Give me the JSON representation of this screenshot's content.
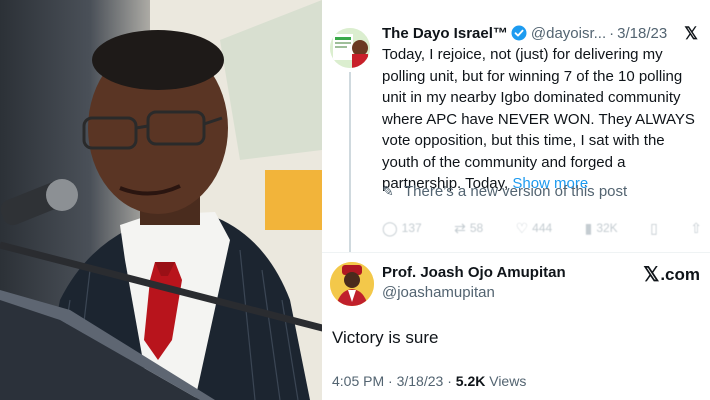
{
  "tweet1": {
    "author_name": "The Dayo Israel™",
    "handle": "@dayoisr...",
    "separator": "·",
    "date": "3/18/23",
    "x_logo": "𝕏",
    "body": "Today, I rejoice, not (just) for delivering my polling unit, but for winning 7 of the 10 polling unit in my nearby Igbo dominated community where APC have NEVER WON. They ALWAYS vote opposition, but this time, I sat with the youth of the community and forged a partnership. Today, ",
    "show_more": "Show more",
    "new_version_notice": "There’s a new version of this post",
    "actions": {
      "replies": "137",
      "reposts": "58",
      "likes": "444",
      "views": "32K"
    }
  },
  "tweet2": {
    "author_name": "Prof. Joash Ojo Amupitan",
    "handle": "@joashamupitan",
    "watermark_x": "𝕏",
    "watermark_text": ".com",
    "body": "Victory is sure",
    "time": "4:05 PM",
    "date": "3/18/23",
    "views_count": "5.2K",
    "views_label": "Views"
  },
  "colors": {
    "text": "#0f1419",
    "secondary": "#536471",
    "link": "#1d9bf0",
    "verified": "#1d9bf0"
  }
}
